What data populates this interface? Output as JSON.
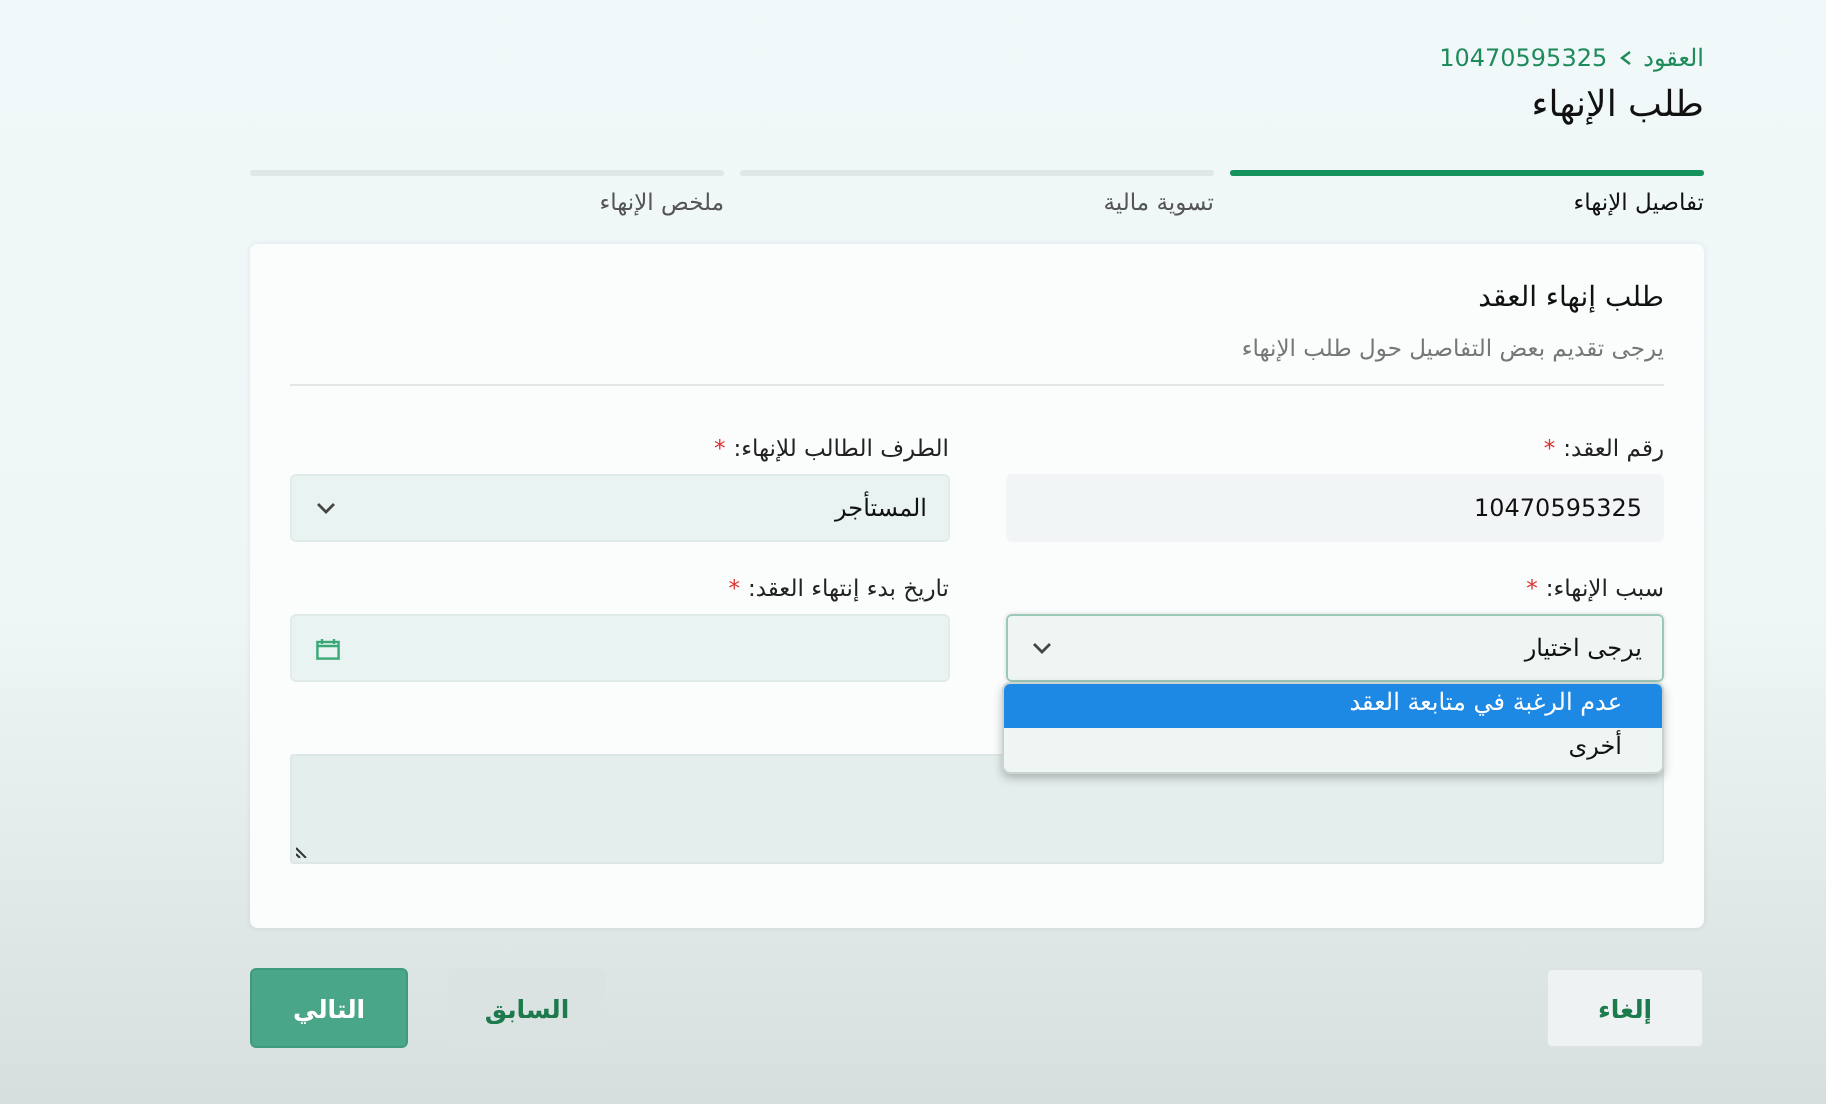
{
  "breadcrumb": {
    "parent": "العقود",
    "current": "10470595325"
  },
  "title": "طلب الإنهاء",
  "steps": [
    {
      "label": "تفاصيل الإنهاء",
      "selected": true
    },
    {
      "label": "تسوية مالية",
      "selected": false
    },
    {
      "label": "ملخص الإنهاء",
      "selected": false
    }
  ],
  "form": {
    "title": "طلب إنهاء العقد",
    "subtitle": "يرجى تقديم بعض التفاصيل حول طلب الإنهاء",
    "fields": [
      {
        "kind": "text",
        "label": "رقم العقد:",
        "required_mark": "*",
        "value": "10470595325"
      },
      {
        "kind": "select",
        "label": "الطرف الطالب للإنهاء:",
        "required_mark": "*",
        "value": "المستأجر",
        "expanded": false
      },
      {
        "kind": "select",
        "label": "سبب الإنهاء:",
        "required_mark": "*",
        "value": "يرجى اختيار",
        "expanded": true,
        "options": [
          {
            "label": "عدم الرغبة في متابعة العقد",
            "selected": true
          },
          {
            "label": "أخرى",
            "selected": false
          }
        ]
      },
      {
        "kind": "date",
        "label": "تاريخ بدء إنتهاء العقد:",
        "required_mark": "*"
      },
      {
        "kind": "textarea"
      }
    ]
  },
  "actions": [
    {
      "label": "إلغاء",
      "kind": "cancel"
    },
    {
      "label": "السابق",
      "kind": "secondary"
    },
    {
      "label": "التالي",
      "kind": "primary"
    }
  ]
}
